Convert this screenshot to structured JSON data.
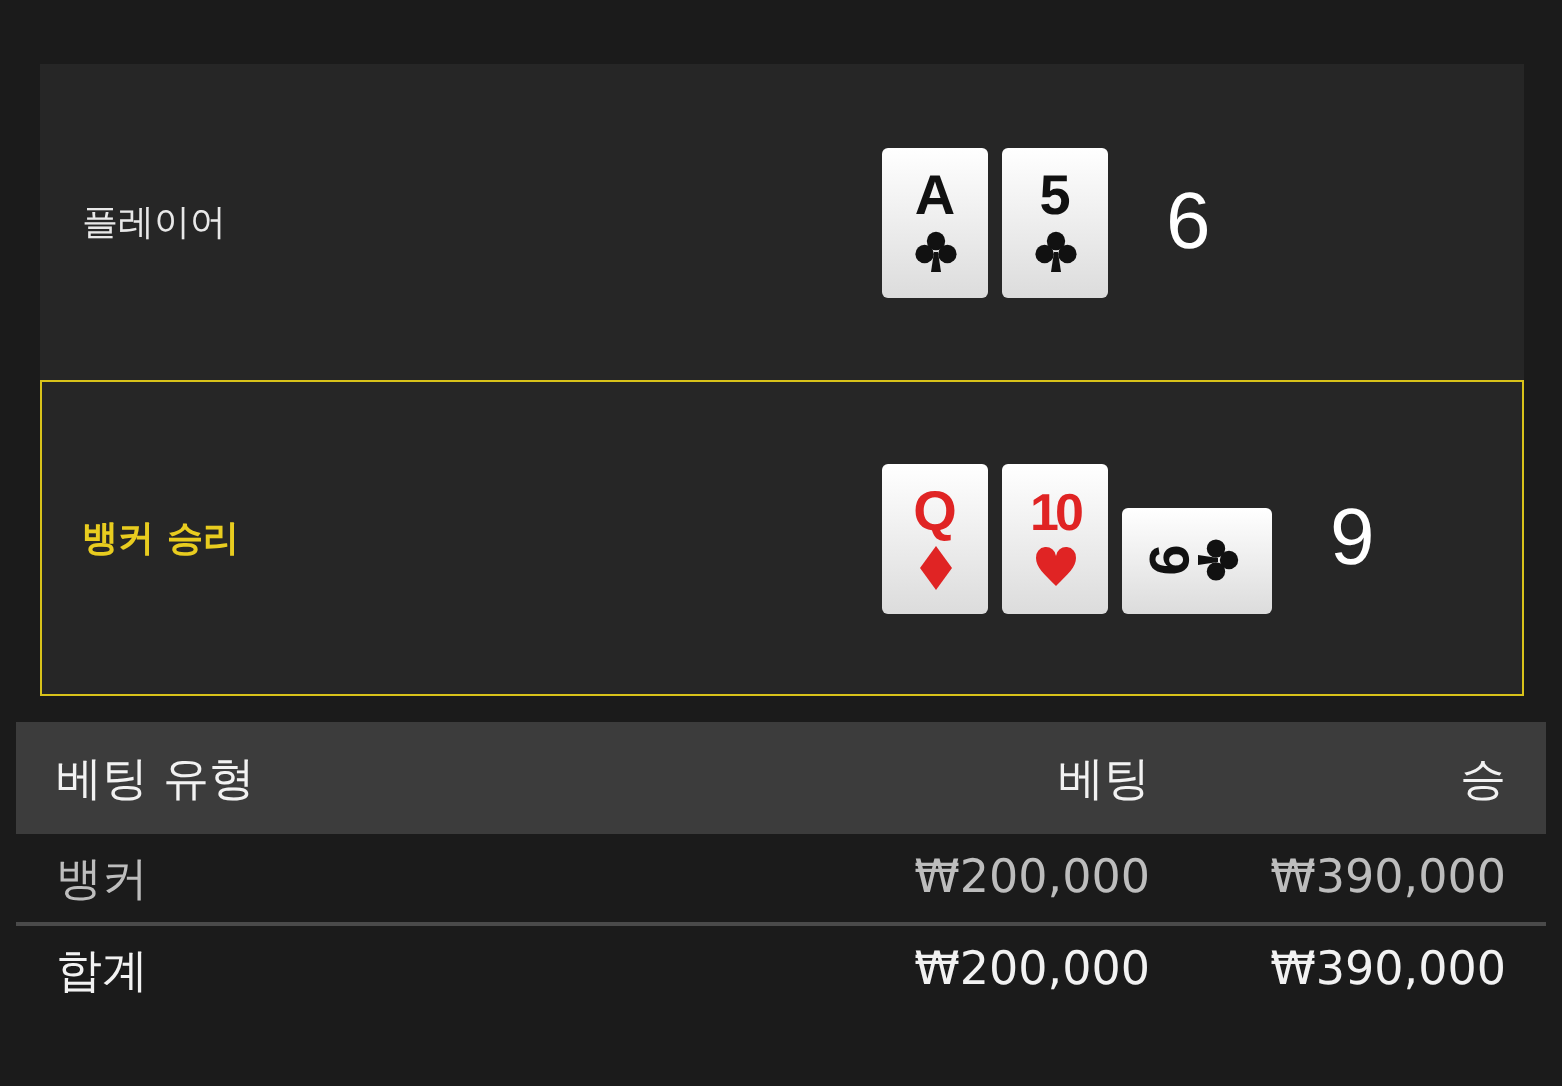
{
  "hands": [
    {
      "label": "플레이어",
      "winner": false,
      "total": "6",
      "cards": [
        {
          "rank": "A",
          "kind": "clubs",
          "sideways": false
        },
        {
          "rank": "5",
          "kind": "clubs",
          "sideways": false
        }
      ]
    },
    {
      "label": "뱅커 승리",
      "winner": true,
      "total": "9",
      "cards": [
        {
          "rank": "Q",
          "kind": "diamonds",
          "sideways": false
        },
        {
          "rank": "10",
          "kind": "hearts",
          "sideways": false
        },
        {
          "rank": "9",
          "kind": "clubs",
          "sideways": true
        }
      ]
    }
  ],
  "table": {
    "columns": [
      "베팅 유형",
      "베팅",
      "승"
    ],
    "rows": [
      {
        "kind": "bet",
        "cells": [
          "뱅커",
          "₩200,000",
          "₩390,000"
        ]
      },
      {
        "kind": "total",
        "cells": [
          "합계",
          "₩200,000",
          "₩390,000"
        ]
      }
    ]
  }
}
